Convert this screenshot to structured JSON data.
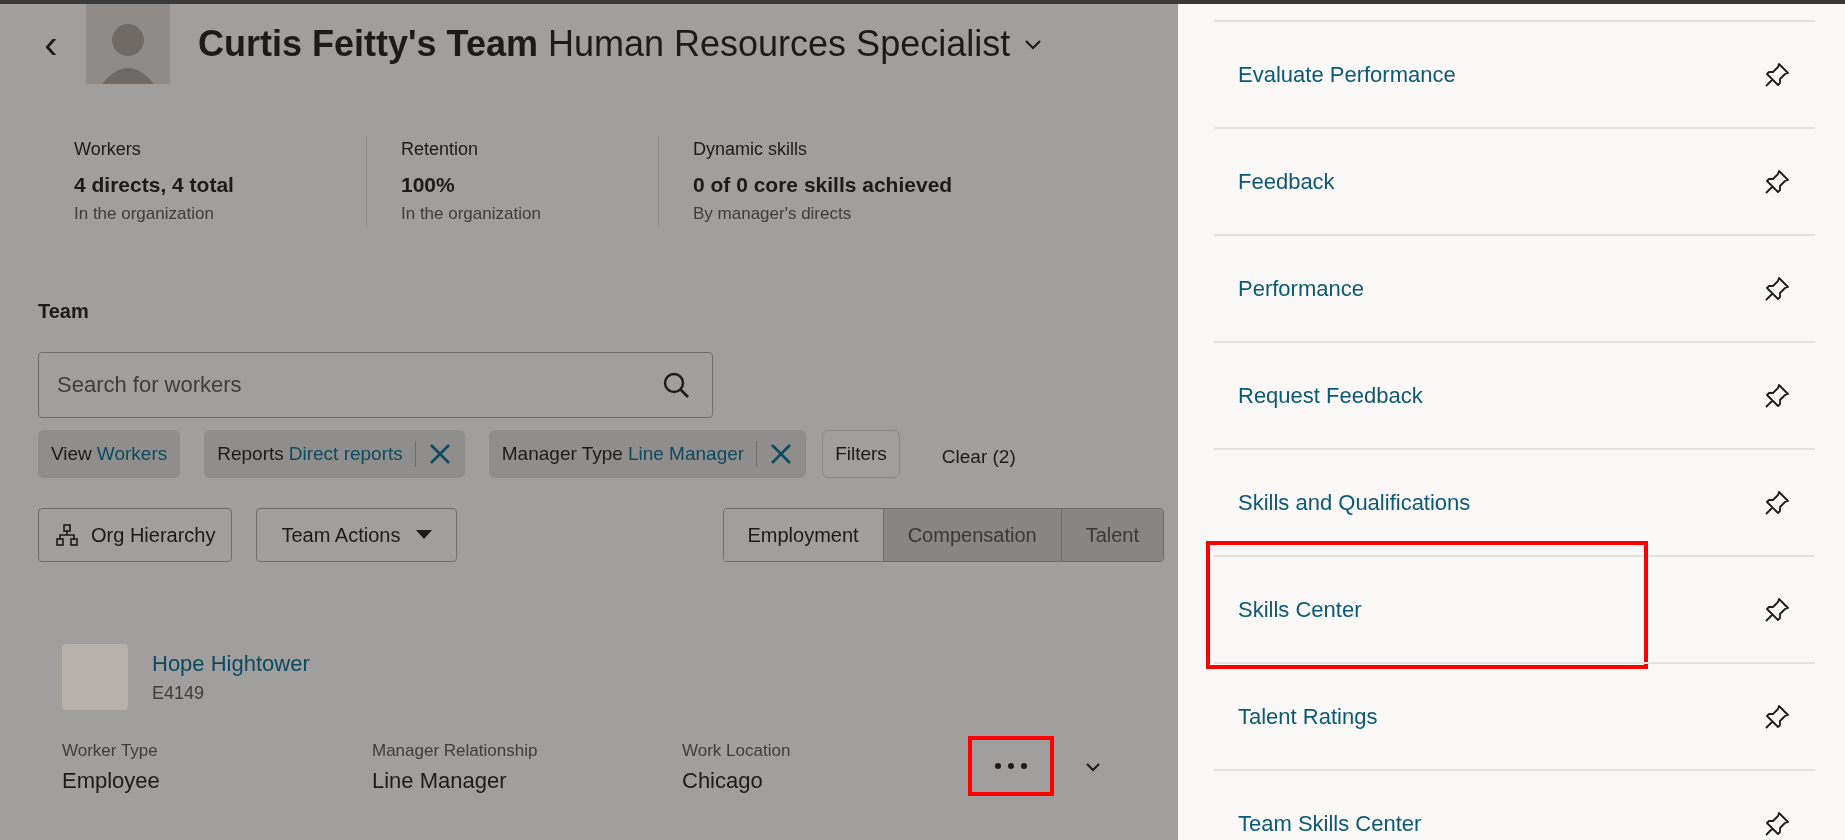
{
  "header": {
    "back": "‹",
    "name": "Curtis Feitty's Team",
    "role": "Human Resources Specialist"
  },
  "stats": [
    {
      "label": "Workers",
      "value": "4 directs, 4 total",
      "note": "In the organization"
    },
    {
      "label": "Retention",
      "value": "100%",
      "note": "In the organization"
    },
    {
      "label": "Dynamic skills",
      "value": "0 of 0 core skills achieved",
      "note": "By manager's directs"
    }
  ],
  "team": {
    "heading": "Team",
    "search": {
      "placeholder": "Search for workers"
    },
    "chips": [
      {
        "label": "View",
        "value": "Workers",
        "removable": false
      },
      {
        "label": "Reports",
        "value": "Direct reports",
        "removable": true
      },
      {
        "label": "Manager Type",
        "value": "Line Manager",
        "removable": true
      }
    ],
    "filters_button": "Filters",
    "clear_button": "Clear (2)",
    "org_button": "Org Hierarchy",
    "actions_button": "Team Actions",
    "views": [
      {
        "label": "Employment",
        "selected": true
      },
      {
        "label": "Compensation",
        "selected": false
      },
      {
        "label": "Talent",
        "selected": false
      }
    ],
    "workers": [
      {
        "name": "Hope Hightower",
        "id": "E4149",
        "more_highlighted": true,
        "fields": [
          {
            "label": "Worker Type",
            "value": "Employee"
          },
          {
            "label": "Manager Relationship",
            "value": "Line Manager"
          },
          {
            "label": "Work Location",
            "value": "Chicago"
          }
        ]
      }
    ]
  },
  "panel": {
    "items": [
      {
        "label": "Evaluate Performance",
        "highlighted": false
      },
      {
        "label": "Feedback",
        "highlighted": false
      },
      {
        "label": "Performance",
        "highlighted": false
      },
      {
        "label": "Request Feedback",
        "highlighted": false
      },
      {
        "label": "Skills and Qualifications",
        "highlighted": false
      },
      {
        "label": "Skills Center",
        "highlighted": true
      },
      {
        "label": "Talent Ratings",
        "highlighted": false
      },
      {
        "label": "Team Skills Center",
        "highlighted": false
      }
    ]
  }
}
